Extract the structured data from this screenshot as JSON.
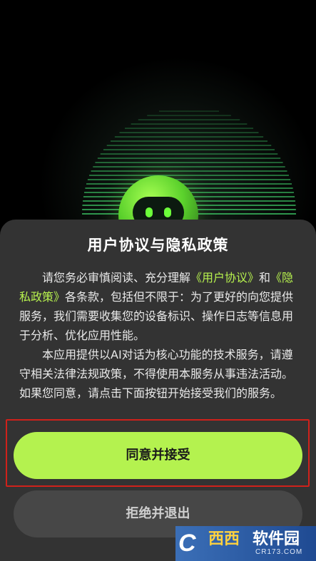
{
  "dialog": {
    "title": "用户协议与隐私政策",
    "paragraph1_pre": "请您务必审慎阅读、充分理解",
    "user_agreement_link": "《用户协议》",
    "and": "和",
    "privacy_policy_link": "《隐私政策》",
    "paragraph1_post": "各条款，包括但不限于：为了更好的向您提供服务，我们需要收集您的设备标识、操作日志等信息用于分析、优化应用性能。",
    "paragraph2": "本应用提供以AI对话为核心功能的技术服务，请遵守相关法律法规政策，不得使用本服务从事违法活动。如果您同意，请点击下面按钮开始接受我们的服务。",
    "accept_label": "同意并接受",
    "reject_label": "拒绝并退出"
  },
  "watermark": {
    "logo": "C",
    "brand": "西西",
    "cn": "软件园",
    "url": "CR173.COM"
  },
  "colors": {
    "accent": "#b4f24f",
    "link": "#b7f24e",
    "sheet": "#333333",
    "highlight": "#d0211b"
  },
  "icons": [
    "mascot-icon"
  ]
}
